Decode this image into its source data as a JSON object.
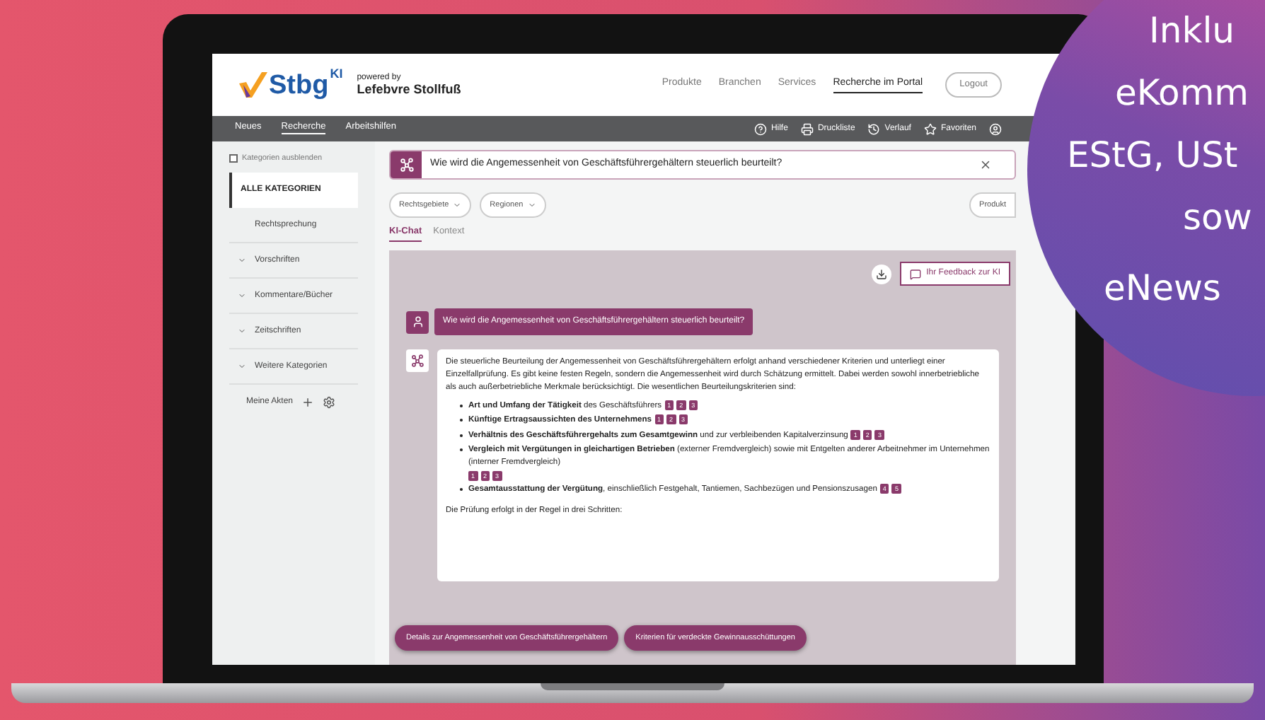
{
  "header": {
    "logo": "Stbg",
    "logo_sup": "KI",
    "powered_by": "powered by",
    "publisher": "Lefebvre Stollfuß",
    "links": [
      {
        "label": "Produkte",
        "selected": false
      },
      {
        "label": "Branchen",
        "selected": false
      },
      {
        "label": "Services",
        "selected": false
      },
      {
        "label": "Recherche im Portal",
        "selected": true
      }
    ],
    "logout": "Logout"
  },
  "navbar": {
    "items": [
      {
        "label": "Neues",
        "selected": false
      },
      {
        "label": "Recherche",
        "selected": true
      },
      {
        "label": "Arbeitshilfen",
        "selected": false
      }
    ],
    "tools": [
      {
        "kind": "help",
        "label": "Hilfe"
      },
      {
        "kind": "print",
        "label": "Druckliste"
      },
      {
        "kind": "history",
        "label": "Verlauf"
      },
      {
        "kind": "star",
        "label": "Favoriten"
      },
      {
        "kind": "user"
      }
    ]
  },
  "sidebar": {
    "hide_toggle": {
      "label": "Kategorien ausblenden",
      "checked": false
    },
    "items": [
      {
        "label": "ALLE KATEGORIEN",
        "selected": true,
        "kind": "all"
      },
      {
        "label": "Rechtsprechung",
        "selected": false,
        "kind": "link"
      },
      {
        "label": "Vorschriften",
        "selected": false,
        "kind": "group"
      },
      {
        "label": "Kommentare/Bücher",
        "selected": false,
        "kind": "group"
      },
      {
        "label": "Zeitschriften",
        "selected": false,
        "kind": "group"
      },
      {
        "label": "Weitere Kategorien",
        "selected": false,
        "kind": "group"
      }
    ],
    "footer": "Meine Akten"
  },
  "search": {
    "value": "Wie wird die Angemessenheit von Geschäftsführergehältern steuerlich beurteilt?"
  },
  "filters": [
    "Rechtsgebiete",
    "Regionen"
  ],
  "product_filter": "Produkt",
  "tabs": [
    {
      "label": "KI-Chat",
      "selected": true
    },
    {
      "label": "Kontext",
      "selected": false
    }
  ],
  "chat": {
    "feedback": "Ihr Feedback zur KI",
    "question": "Wie wird die Angemessenheit von Geschäftsführergehältern steuerlich beurteilt?",
    "answer_intro": "Die steuerliche Beurteilung der Angemessenheit von Geschäftsführergehältern erfolgt anhand verschiedener Kriterien und unterliegt einer Einzelfallprüfung. Es gibt keine festen Regeln, sondern die Angemessenheit wird durch Schätzung ermittelt. Dabei werden sowohl innerbetriebliche als auch außerbetriebliche Merkmale berücksichtigt. Die wesentlichen Beurteilungskriterien sind:",
    "bullets": [
      {
        "text": "**Art und Umfang der Tätigkeit** des Geschäftsführers",
        "citations": [
          "1",
          "2",
          "3"
        ]
      },
      {
        "text": "**Künftige Ertragsaussichten des Unternehmens**",
        "citations": [
          "1",
          "2",
          "3"
        ]
      },
      {
        "text": "**Verhältnis des Geschäftsführergehalts zum Gesamtgewinn** und zur verbleibenden Kapitalverzinsung",
        "citations": [
          "1",
          "2",
          "3"
        ]
      },
      {
        "text": "**Vergleich mit Vergütungen in gleichartigen Betrieben** (externer Fremdvergleich) sowie mit Entgelten anderer Arbeitnehmer im Unternehmen (interner Fremdvergleich)",
        "citations": [
          "1",
          "2",
          "3"
        ]
      },
      {
        "text": "**Gesamtausstattung der Vergütung**, einschließlich Festgehalt, Tantiemen, Sachbezügen und Pensionszusagen",
        "citations": [
          "4",
          "5"
        ]
      }
    ],
    "answer_outro": "Die Prüfung erfolgt in der Regel in drei Schritten:",
    "suggestions": [
      "Details zur Angemessenheit von Geschäftsführergehältern",
      "Kriterien für verdeckte Gewinnausschüttungen"
    ]
  },
  "promo": {
    "lines": [
      "Inklu",
      "eKomm",
      "EStG, USt",
      "sow",
      "eNews"
    ]
  }
}
